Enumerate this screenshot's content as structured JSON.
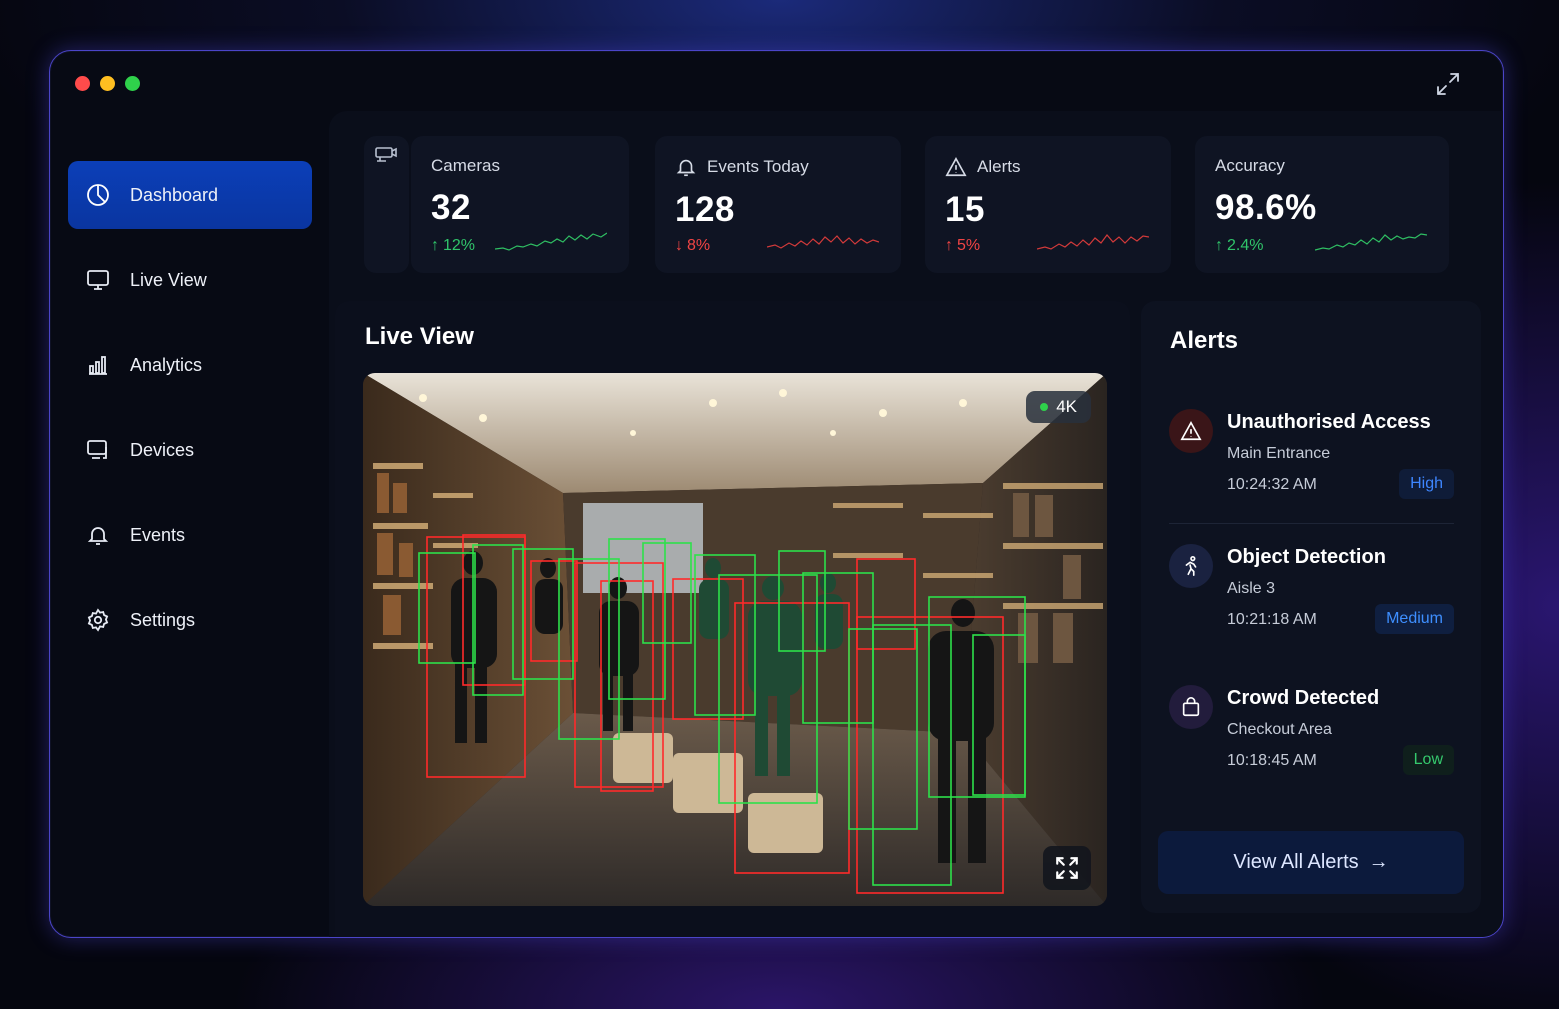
{
  "window": {
    "controls": [
      "close",
      "minimize",
      "maximize"
    ]
  },
  "sidebar": {
    "items": [
      {
        "label": "Dashboard",
        "icon": "pie-chart-icon",
        "active": true
      },
      {
        "label": "Live View",
        "icon": "monitor-icon"
      },
      {
        "label": "Analytics",
        "icon": "bar-chart-icon"
      },
      {
        "label": "Devices",
        "icon": "devices-icon"
      },
      {
        "label": "Events",
        "icon": "bell-icon"
      },
      {
        "label": "Settings",
        "icon": "gear-icon"
      }
    ]
  },
  "stats": [
    {
      "label": "Cameras",
      "value": "32",
      "change": "12%",
      "direction": "up"
    },
    {
      "label": "Events Today",
      "value": "128",
      "change": "8%",
      "direction": "down"
    },
    {
      "label": "Alerts",
      "value": "15",
      "change": "5%",
      "direction": "up"
    },
    {
      "label": "Accuracy",
      "value": "98.6%",
      "change": "2.4%",
      "direction": "up"
    }
  ],
  "live_view": {
    "title": "Live View",
    "resolution": "4K"
  },
  "alerts": {
    "title": "Alerts",
    "items": [
      {
        "title": "Unauthorised Access",
        "location": "Main Entrance",
        "time": "10:24:32 AM",
        "severity": "High"
      },
      {
        "title": "Object Detection",
        "location": "Aisle 3",
        "time": "10:21:18 AM",
        "severity": "Medium"
      },
      {
        "title": "Crowd Detected",
        "location": "Checkout Area",
        "time": "10:18:45 AM",
        "severity": "Low"
      }
    ],
    "view_all_label": "View All Alerts"
  },
  "colors": {
    "accent": "#0b3fb8",
    "up": "#30c46a",
    "down": "#f04444",
    "border": "#4b45c8"
  }
}
